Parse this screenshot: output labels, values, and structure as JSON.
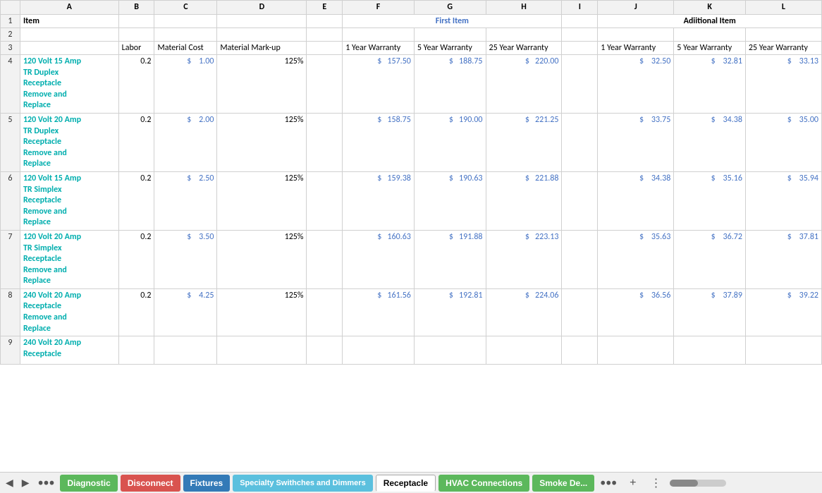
{
  "columns": [
    "",
    "A",
    "B",
    "C",
    "D",
    "E",
    "F",
    "G",
    "H",
    "I",
    "J",
    "K",
    "L"
  ],
  "rows": [
    {
      "rowNum": "1",
      "cells": {
        "a": {
          "text": "Item",
          "style": "bold"
        },
        "b": "",
        "c": "",
        "d": "",
        "e": "",
        "f": {
          "text": "First Item",
          "style": "bold cyan merged"
        },
        "g": "",
        "h": "",
        "i": "",
        "j": {
          "text": "Adiitional Item",
          "style": "bold merged"
        },
        "k": "",
        "l": ""
      }
    },
    {
      "rowNum": "2",
      "cells": {
        "a": "",
        "b": "",
        "c": "",
        "d": "",
        "e": "",
        "f": "",
        "g": "",
        "h": "",
        "i": "",
        "j": "",
        "k": "",
        "l": ""
      }
    },
    {
      "rowNum": "3",
      "cells": {
        "a": "",
        "b": {
          "text": "Labor"
        },
        "c": {
          "text": "Material Cost"
        },
        "d": {
          "text": "Material Mark-up"
        },
        "e": "",
        "f": {
          "text": "1 Year Warranty"
        },
        "g": {
          "text": "5 Year Warranty"
        },
        "h": {
          "text": "25 Year Warranty"
        },
        "i": "",
        "j": {
          "text": "1 Year Warranty"
        },
        "k": {
          "text": "5 Year Warranty"
        },
        "l": {
          "text": "25 Year Warranty"
        }
      }
    },
    {
      "rowNum": "4",
      "label": "120 Volt 15 Amp\nTR Duplex\nReceptacle\nRemove and\nReplace",
      "labor": "0.2",
      "mat_cost": "1.00",
      "mark_up": "125%",
      "f": "157.50",
      "g": "188.75",
      "h": "220.00",
      "j": "32.50",
      "k": "32.81",
      "l": "33.13"
    },
    {
      "rowNum": "5",
      "label": "120 Volt 20 Amp\nTR Duplex\nReceptacle\nRemove and\nReplace",
      "labor": "0.2",
      "mat_cost": "2.00",
      "mark_up": "125%",
      "f": "158.75",
      "g": "190.00",
      "h": "221.25",
      "j": "33.75",
      "k": "34.38",
      "l": "35.00"
    },
    {
      "rowNum": "6",
      "label": "120 Volt 15 Amp\nTR Simplex\nReceptacle\nRemove and\nReplace",
      "labor": "0.2",
      "mat_cost": "2.50",
      "mark_up": "125%",
      "f": "159.38",
      "g": "190.63",
      "h": "221.88",
      "j": "34.38",
      "k": "35.16",
      "l": "35.94"
    },
    {
      "rowNum": "7",
      "label": "120 Volt 20 Amp\nTR Simplex\nReceptacle\nRemove and\nReplace",
      "labor": "0.2",
      "mat_cost": "3.50",
      "mark_up": "125%",
      "f": "160.63",
      "g": "191.88",
      "h": "223.13",
      "j": "35.63",
      "k": "36.72",
      "l": "37.81"
    },
    {
      "rowNum": "8",
      "label": "240 Volt 20 Amp\nReceptacle\nRemove and\nReplace",
      "labor": "0.2",
      "mat_cost": "4.25",
      "mark_up": "125%",
      "f": "161.56",
      "g": "192.81",
      "h": "224.06",
      "j": "36.56",
      "k": "37.89",
      "l": "39.22"
    },
    {
      "rowNum": "9",
      "label": "240 Volt 20 Amp\nReceptacle",
      "partial": true
    }
  ],
  "tabs": [
    {
      "label": "Diagnostic",
      "color": "green",
      "active": false
    },
    {
      "label": "Disconnect",
      "color": "red",
      "active": false
    },
    {
      "label": "Fixtures",
      "color": "blue-tab",
      "active": false
    },
    {
      "label": "Specialty Swithches and Dimmers",
      "color": "teal",
      "active": false
    },
    {
      "label": "Receptacle",
      "color": "active-tab",
      "active": true
    },
    {
      "label": "HVAC Connections",
      "color": "green",
      "active": false
    },
    {
      "label": "Smoke De...",
      "color": "green",
      "active": false
    }
  ]
}
